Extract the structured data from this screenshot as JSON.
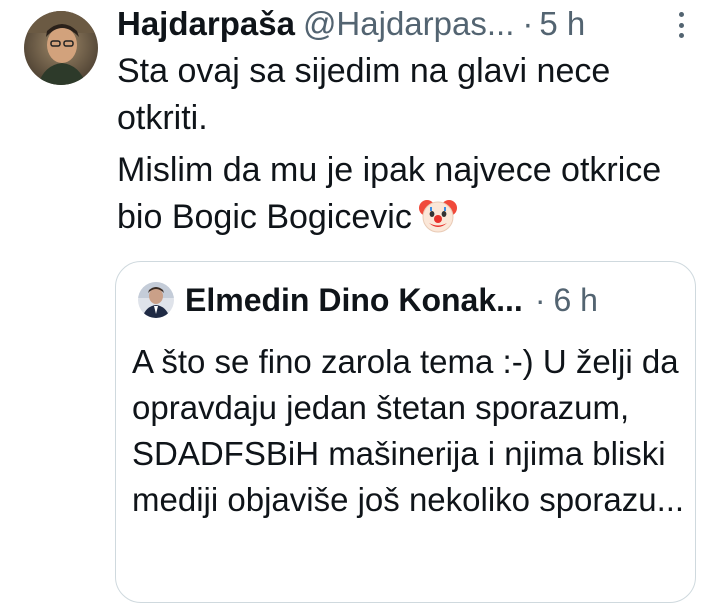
{
  "tweet": {
    "display_name": "Hajdarpaša",
    "handle": "@Hajdarpas...",
    "separator": "·",
    "time": "5 h",
    "text_line1": "Sta ovaj sa sijedim na glavi nece otkriti.",
    "text_line2": "Mislim da mu je ipak najvece otkrice bio Bogic Bogicevic",
    "emoji": "clown-face-icon"
  },
  "quote": {
    "display_name": "Elmedin Dino Konak...",
    "separator": "·",
    "time": "6 h",
    "text": "A što se fino zarola tema :-) U želji da opravdaju jedan štetan sporazum, SDADFSBiH mašinerija i njima bliski mediji objaviše još nekoliko sporazu..."
  },
  "colors": {
    "text_primary": "#0f1419",
    "text_secondary": "#536471",
    "border": "#cfd9de"
  }
}
